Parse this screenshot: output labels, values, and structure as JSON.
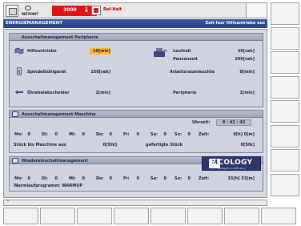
{
  "topbar": {
    "refpoint_label": "REFPOINT",
    "alarm_number": "3000",
    "alarm_text": "Ref-Halt"
  },
  "title": {
    "left": "ENERGIEMANAGEMENT",
    "right": "Zeit fuer Hilfsantriebe aus"
  },
  "panel1": {
    "title": "Ausschaltmanagement Peripherie",
    "hilfsantriebe_label": "Hilfsantriebe",
    "hilfsantriebe_value": "10[min]",
    "laufzeit_label": "Laufzeit",
    "laufzeit_value": "30[sek]",
    "pausenzeit_label": "Pausenzeit",
    "pausenzeit_value": "200[sek]",
    "spindel_label": "Spindelkühlgerät",
    "spindel_value": "150[sek]",
    "arbeitsraum_label": "Arbeitsraumleuchte",
    "arbeitsraum_value": "0[min]",
    "oel_label": "Ölnebelabscheider",
    "oel_value": "2[min]",
    "peripherie_label": "Peripherie",
    "peripherie_value": "1[min]"
  },
  "panel2": {
    "title": "Ausschaltmanagement Maschine",
    "uhrzeit_label": "Uhrzeit:",
    "uhrzeit_value": "8 : 42 : 42",
    "days": [
      {
        "label": "Mo:",
        "value": "0"
      },
      {
        "label": "Di:",
        "value": "0"
      },
      {
        "label": "Mi:",
        "value": "0"
      },
      {
        "label": "Do:",
        "value": "0"
      },
      {
        "label": "Fr:",
        "value": "0"
      },
      {
        "label": "Sa:",
        "value": "0"
      },
      {
        "label": "So:",
        "value": "0"
      }
    ],
    "zeit_label": "Zeit:",
    "zeit_value": "0[h] 0[m]",
    "stueck_label": "Stück bis Maschine aus",
    "stueck_value": "0[Stk]",
    "gefertigt_label": "gefertigte Stück",
    "gefertigt_value": "0[Stk]"
  },
  "panel3": {
    "title": "Wiedereinschaltmanagement",
    "days": [
      {
        "label": "Mo:",
        "value": "0"
      },
      {
        "label": "Di:",
        "value": "0"
      },
      {
        "label": "Mi:",
        "value": "0"
      },
      {
        "label": "Do:",
        "value": "0"
      },
      {
        "label": "Fr:",
        "value": "0"
      },
      {
        "label": "Sa:",
        "value": "0"
      },
      {
        "label": "So:",
        "value": "0"
      }
    ],
    "zeit_label": "Zeit:",
    "zeit_value": "15[h] 53[m]",
    "warmlauf_label": "Warmlaufprogramm: WARMUP",
    "logo_text": "E   COLOGY",
    "logo_em": "M",
    "logo_sub": "Intelligent for Efficiency"
  },
  "colors": {
    "title_bar": "#26407f",
    "alarm": "#e31212",
    "highlight": "#ffb43a"
  }
}
